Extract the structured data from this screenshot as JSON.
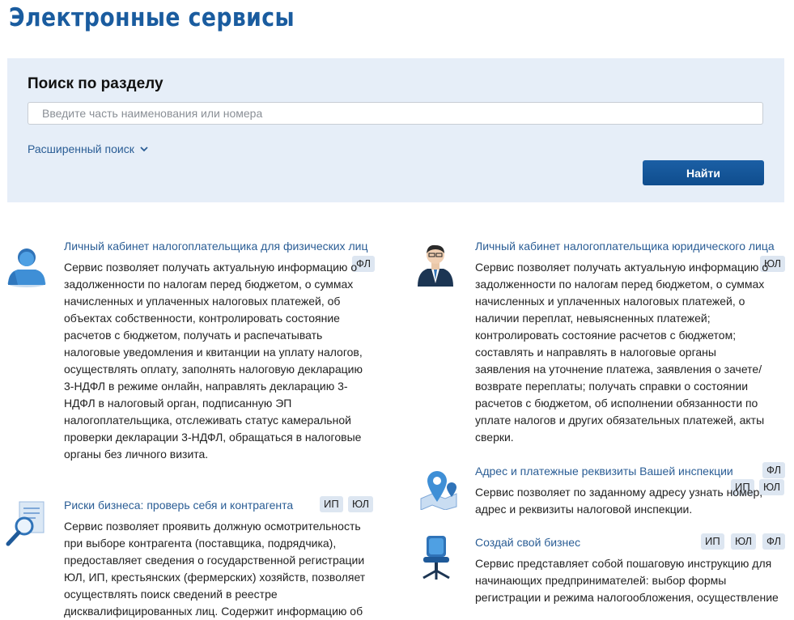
{
  "header": {
    "title": "Электронные сервисы"
  },
  "search": {
    "title": "Поиск по разделу",
    "placeholder": "Введите часть наименования или номера",
    "advanced_label": "Расширенный поиск",
    "button_label": "Найти"
  },
  "services": [
    {
      "title": "Личный кабинет налогоплательщика для физических лиц",
      "description": "Сервис позволяет получать актуальную информацию о задолженности по налогам перед бюджетом, о суммах начисленных и уплаченных налоговых платежей, об объектах собственности, контролировать состояние расчетов с бюджетом, получать и распечатывать налоговые уведомления и квитанции на уплату налогов, осуществлять оплату, заполнять налоговую декларацию 3-НДФЛ в режиме онлайн, направлять декларацию 3-НДФЛ в налоговый орган, подписанную ЭП налогоплательщика, отслеживать статус камеральной проверки декларации 3-НДФЛ, обращаться в налоговые органы без личного визита.",
      "badges": [
        "ФЛ"
      ],
      "icon": "person-icon"
    },
    {
      "title": "Риски бизнеса: проверь себя и контрагента",
      "description": "Сервис позволяет проявить должную осмотрительность при выборе контрагента (поставщика, подрядчика), предоставляет сведения о государственной регистрации ЮЛ, ИП, крестьянских (фермерских) хозяйств, позволяет осуществлять поиск сведений в реестре дисквалифицированных лиц. Содержит информацию об",
      "badges": [
        "ИП",
        "ЮЛ"
      ],
      "icon": "magnifier-document-icon"
    },
    {
      "title": "Личный кабинет налогоплательщика юридического лица",
      "description": "Сервис позволяет получать актуальную информацию о задолженности по налогам перед бюджетом, о суммах начисленных и уплаченных налоговых платежей, о наличии переплат, невыясненных платежей; контролировать состояние расчетов с бюджетом; составлять и направлять в налоговые органы заявления на уточнение платежа, заявления о зачете/возврате переплаты; получать справки о состоянии расчетов с бюджетом, об исполнении обязанности по уплате налогов и других обязательных платежей, акты сверки.",
      "badges": [
        "ЮЛ"
      ],
      "icon": "businessman-icon"
    },
    {
      "title": "Адрес и платежные реквизиты Вашей инспекции",
      "description": "Сервис позволяет по заданному адресу узнать номер, адрес и реквизиты налоговой инспекции.",
      "badges": [
        "ФЛ",
        "ИП",
        "ЮЛ"
      ],
      "icon": "map-pin-icon"
    },
    {
      "title": "Создай свой бизнес",
      "description": "Сервис представляет собой пошаговую инструкцию для начинающих предпринимателей: выбор формы регистрации и режима налогообложения, осуществление",
      "badges": [
        "ИП",
        "ЮЛ",
        "ФЛ"
      ],
      "icon": "office-chair-icon"
    }
  ],
  "colors": {
    "accent": "#1a5c9f",
    "link": "#2a5d95",
    "panel": "#e6eef8",
    "badge": "#dde6f1"
  }
}
